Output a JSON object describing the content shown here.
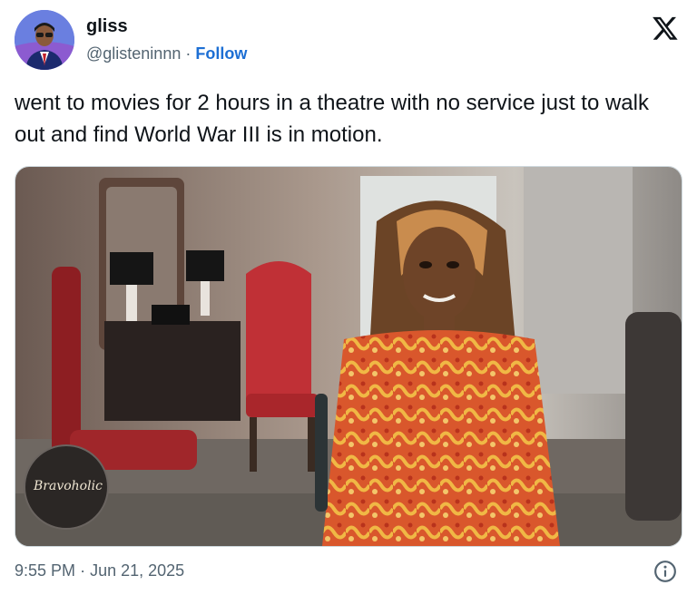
{
  "user": {
    "display_name": "gliss",
    "handle": "@glisteninnn",
    "separator": "·",
    "follow_label": "Follow",
    "avatar_icon": "avatar"
  },
  "platform_icon": "x-logo-icon",
  "tweet": {
    "text": "went to movies for 2 hours in a theatre with no service just to walk out and find World War III is in motion."
  },
  "media": {
    "watermark": "Bravoholic"
  },
  "meta": {
    "time": "9:55 PM",
    "separator": "·",
    "date": "Jun 21, 2025",
    "info_icon": "info-icon"
  },
  "colors": {
    "link": "#1d6fd4",
    "muted": "#536471",
    "text": "#0f1419"
  }
}
